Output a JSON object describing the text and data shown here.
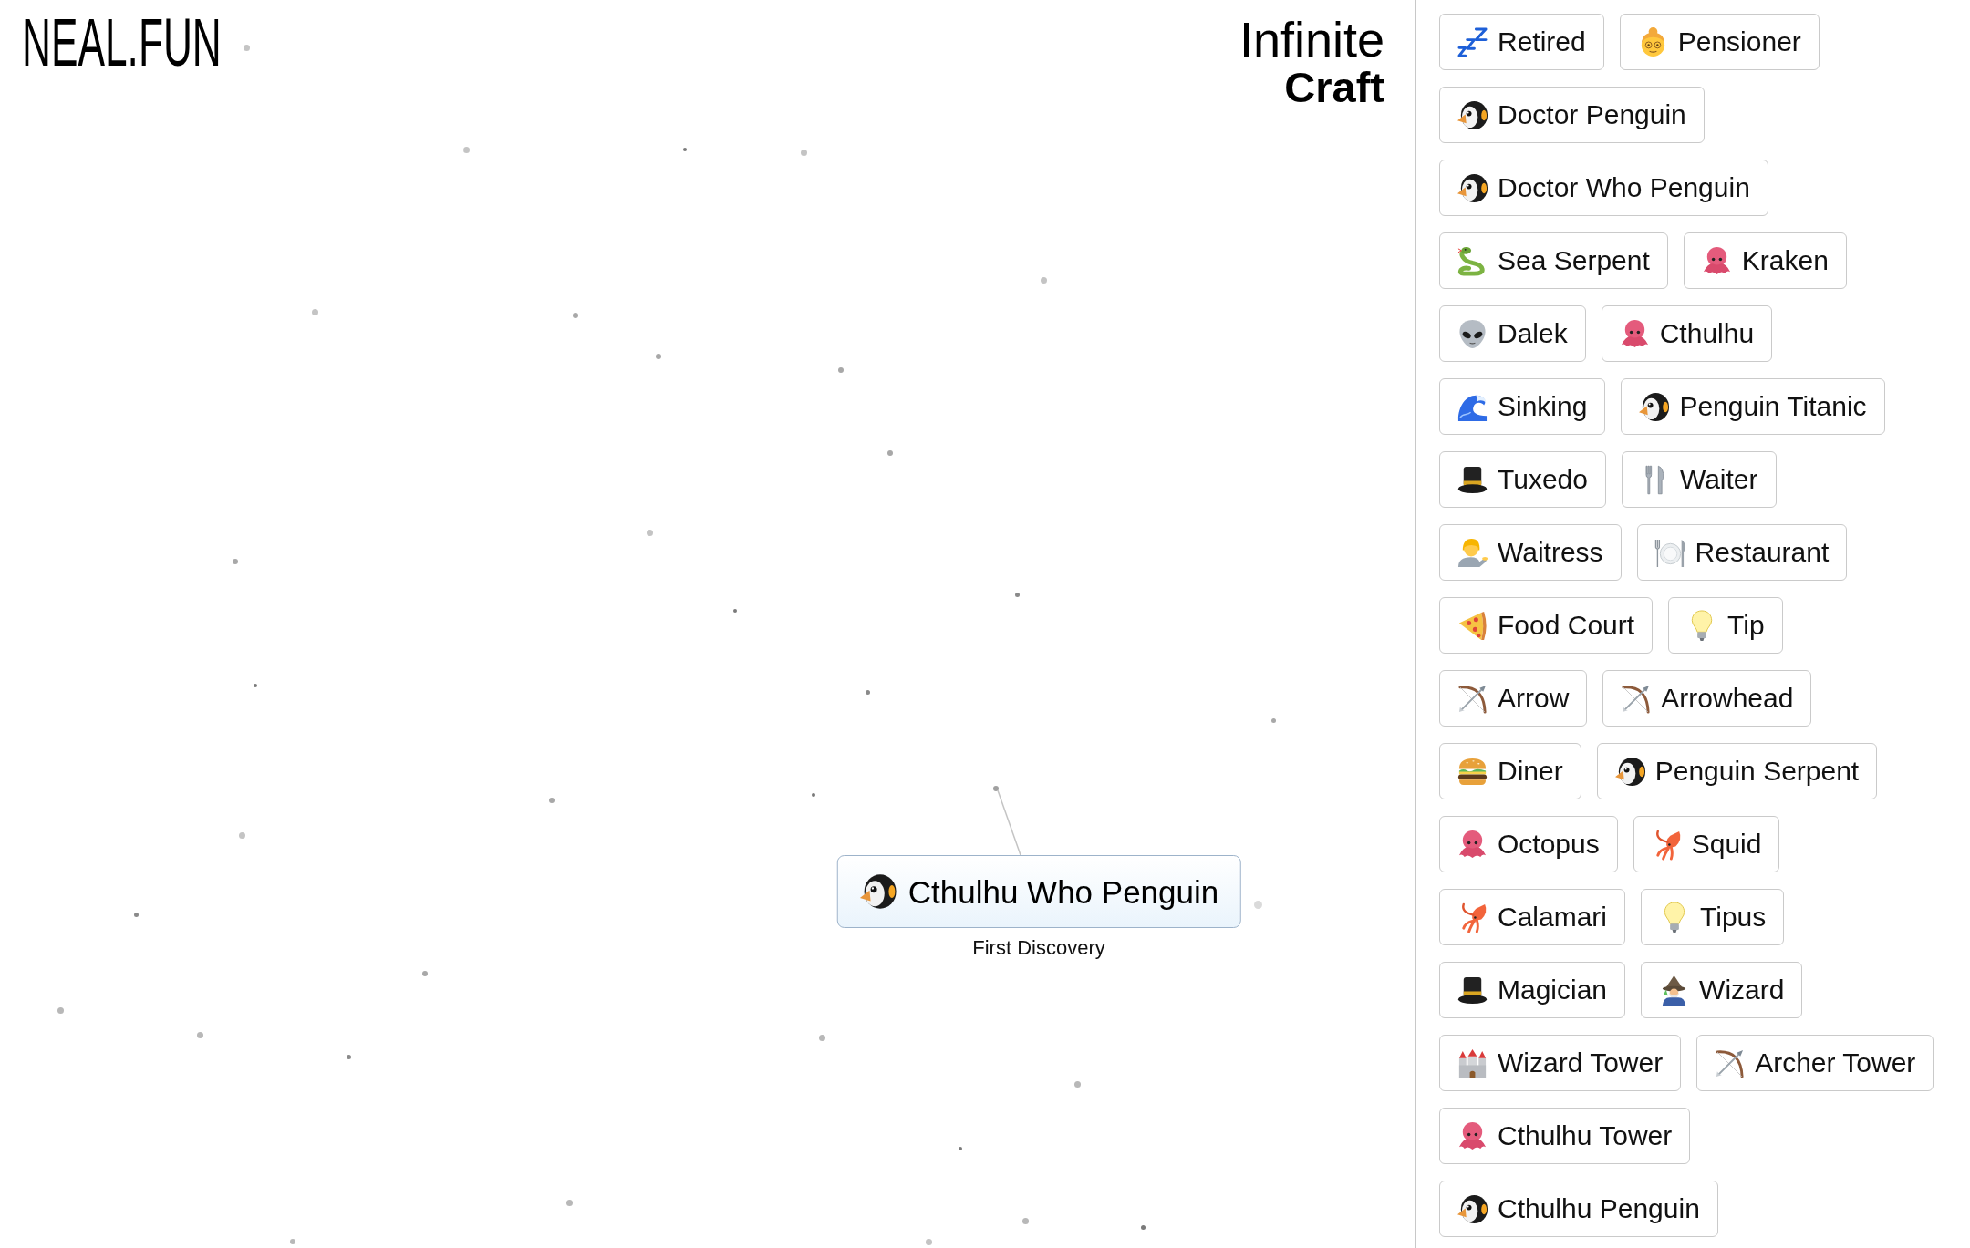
{
  "logo": "NEAL.FUN",
  "title": {
    "line_1": "Infinite",
    "line_2": "Craft"
  },
  "canvas": {
    "element": {
      "kind": "penguin",
      "label": "Cthulhu Who Penguin",
      "note": "First Discovery"
    }
  },
  "sidebar": {
    "rows": [
      [
        {
          "kind": "zzz",
          "label": "Retired"
        },
        {
          "kind": "elder",
          "label": "Pensioner"
        }
      ],
      [
        {
          "kind": "penguin",
          "label": "Doctor Penguin"
        }
      ],
      [
        {
          "kind": "penguin",
          "label": "Doctor Who Penguin"
        }
      ],
      [
        {
          "kind": "snake",
          "label": "Sea Serpent"
        },
        {
          "kind": "octopus",
          "label": "Kraken"
        }
      ],
      [
        {
          "kind": "alien",
          "label": "Dalek"
        },
        {
          "kind": "octopus",
          "label": "Cthulhu"
        }
      ],
      [
        {
          "kind": "wave",
          "label": "Sinking"
        },
        {
          "kind": "penguin",
          "label": "Penguin Titanic"
        }
      ],
      [
        {
          "kind": "tophat",
          "label": "Tuxedo"
        },
        {
          "kind": "cutlery",
          "label": "Waiter"
        }
      ],
      [
        {
          "kind": "person",
          "label": "Waitress"
        },
        {
          "kind": "plate",
          "label": "Restaurant"
        }
      ],
      [
        {
          "kind": "pizza",
          "label": "Food Court"
        },
        {
          "kind": "bulb",
          "label": "Tip"
        }
      ],
      [
        {
          "kind": "bow",
          "label": "Arrow"
        },
        {
          "kind": "bow",
          "label": "Arrowhead"
        }
      ],
      [
        {
          "kind": "burger",
          "label": "Diner"
        },
        {
          "kind": "penguin",
          "label": "Penguin Serpent"
        }
      ],
      [
        {
          "kind": "octopus",
          "label": "Octopus"
        },
        {
          "kind": "squid",
          "label": "Squid"
        }
      ],
      [
        {
          "kind": "squid",
          "label": "Calamari"
        },
        {
          "kind": "bulb",
          "label": "Tipus"
        }
      ],
      [
        {
          "kind": "tophat",
          "label": "Magician"
        },
        {
          "kind": "mage",
          "label": "Wizard"
        }
      ],
      [
        {
          "kind": "castle",
          "label": "Wizard Tower"
        },
        {
          "kind": "bow",
          "label": "Archer Tower"
        }
      ],
      [
        {
          "kind": "octopus",
          "label": "Cthulhu Tower"
        }
      ],
      [
        {
          "kind": "penguin",
          "label": "Cthulhu Penguin"
        }
      ]
    ]
  }
}
